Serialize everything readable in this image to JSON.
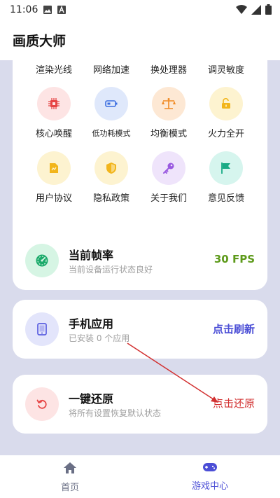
{
  "status_bar": {
    "time": "11:06"
  },
  "app_title": "画质大师",
  "top_row_labels": [
    "渲染光线",
    "网络加速",
    "换处理器",
    "调灵敏度"
  ],
  "mode_row": [
    {
      "label": "核心唤醒",
      "icon": "chip-icon",
      "bg": "#fde4e4",
      "fg": "#e64545"
    },
    {
      "label": "低功耗模式",
      "icon": "battery-icon",
      "bg": "#dfe8fb",
      "fg": "#3d6fe0"
    },
    {
      "label": "均衡模式",
      "icon": "scale-icon",
      "bg": "#fde8d4",
      "fg": "#f08a24"
    },
    {
      "label": "火力全开",
      "icon": "unlock-icon",
      "bg": "#fdf3d0",
      "fg": "#f2b51b"
    }
  ],
  "info_row": [
    {
      "label": "用户协议",
      "icon": "document-icon",
      "bg": "#fdf3d0",
      "fg": "#f2b51b"
    },
    {
      "label": "隐私政策",
      "icon": "shield-icon",
      "bg": "#fdf3d0",
      "fg": "#f2b51b"
    },
    {
      "label": "关于我们",
      "icon": "key-icon",
      "bg": "#efe4fb",
      "fg": "#9a5ae0"
    },
    {
      "label": "意见反馈",
      "icon": "flag-icon",
      "bg": "#d6f5ee",
      "fg": "#1aaa85"
    }
  ],
  "fps_card": {
    "title": "当前帧率",
    "subtitle": "当前设备运行状态良好",
    "value": "30 FPS",
    "value_color": "#5d9a1a",
    "icon_bg": "#d6f5e4",
    "icon_fg": "#1aaa6a"
  },
  "apps_card": {
    "title": "手机应用",
    "subtitle": "已安装 0 个应用",
    "action": "点击刷新",
    "action_color": "#4b4ed6",
    "icon_bg": "#e3e5fb",
    "icon_fg": "#5b5fe0"
  },
  "restore_card": {
    "title": "一键还原",
    "subtitle": "将所有设置恢复默认状态",
    "action": "点击还原",
    "action_color": "#d23030",
    "icon_bg": "#fde4e4",
    "icon_fg": "#e64545"
  },
  "bottom_nav": [
    {
      "label": "首页",
      "icon": "home-icon",
      "color": "#6a6f85"
    },
    {
      "label": "游戏中心",
      "icon": "gamepad-icon",
      "color": "#4b4ed6"
    }
  ]
}
